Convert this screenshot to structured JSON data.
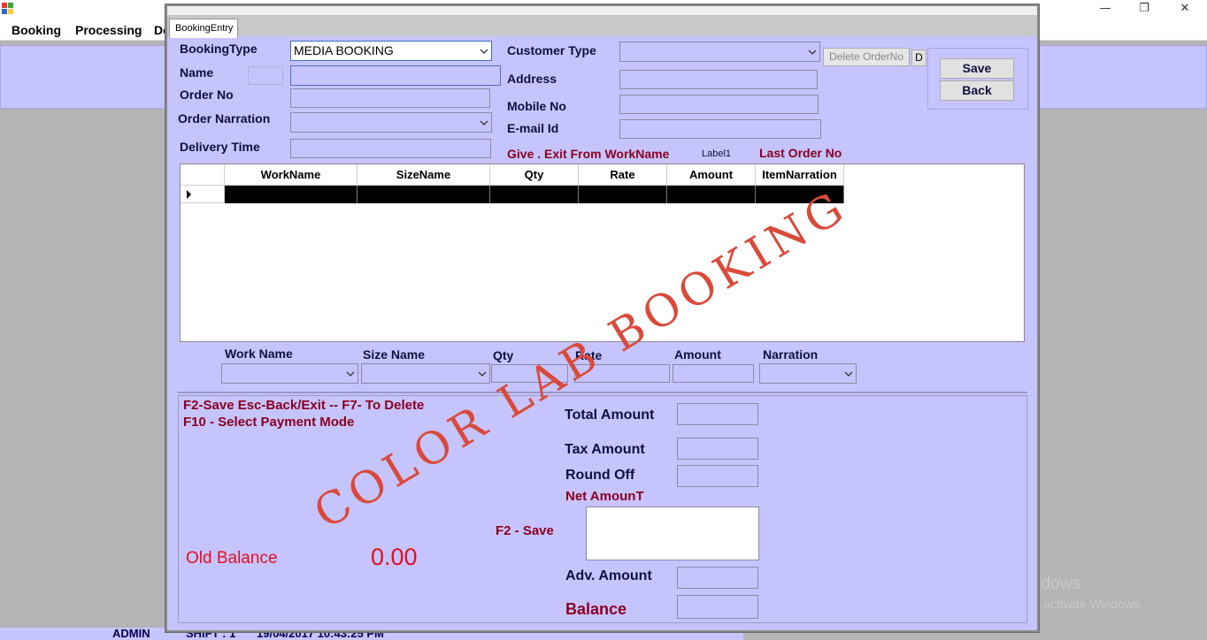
{
  "window": {
    "min": "—",
    "max": "❐",
    "close": "✕"
  },
  "menu": [
    "Booking",
    "Processing",
    "De"
  ],
  "status": {
    "user": "ADMIN",
    "shift": "SHIFT : 1",
    "datetime": "19/04/2017  10:43:25 PM"
  },
  "form": {
    "tab": "BookingEntry",
    "booking_type_label": "BookingType",
    "booking_type_value": "MEDIA BOOKING",
    "name_label": "Name",
    "order_no_label": "Order No",
    "order_narration_label": "Order Narration",
    "delivery_time_label": "Delivery Time",
    "customer_type_label": "Customer Type",
    "address_label": "Address",
    "mobile_label": "Mobile No",
    "email_label": "E-mail Id",
    "delete_order_label": "Delete OrderNo",
    "d_label": "D",
    "save_label": "Save",
    "back_label": "Back",
    "give_exit": "Give .  Exit From WorkName",
    "label1": "Label1",
    "last_order": "Last Order No"
  },
  "grid": {
    "columns": [
      "WorkName",
      "SizeName",
      "Qty",
      "Rate",
      "Amount",
      "ItemNarration"
    ]
  },
  "entry": {
    "work_name": "Work Name",
    "size_name": "Size Name",
    "qty": "Qty",
    "rate": "Rate",
    "amount": "Amount",
    "narration": "Narration"
  },
  "footer": {
    "hint1": "F2-Save  Esc-Back/Exit -- F7- To Delete",
    "hint2": "F10 - Select Payment Mode",
    "total_amount": "Total Amount",
    "tax_amount": "Tax Amount",
    "round_off": "Round Off",
    "net_amount": "Net AmounT",
    "f2_save": "F2 - Save",
    "adv_amount": "Adv. Amount",
    "balance": "Balance",
    "old_balance_label": "Old Balance",
    "old_balance_value": "0.00"
  },
  "watermark": "COLOR LAB BOOKING",
  "activate": {
    "line1": "Activate Windows",
    "line2": "Go to Settings to activate Windows."
  },
  "colors": {
    "form_bg": "#c6c4fd",
    "label_dark": "#101040",
    "label_red": "#8b0020",
    "old_balance": "#e01020",
    "watermark": "#d94a3a"
  }
}
